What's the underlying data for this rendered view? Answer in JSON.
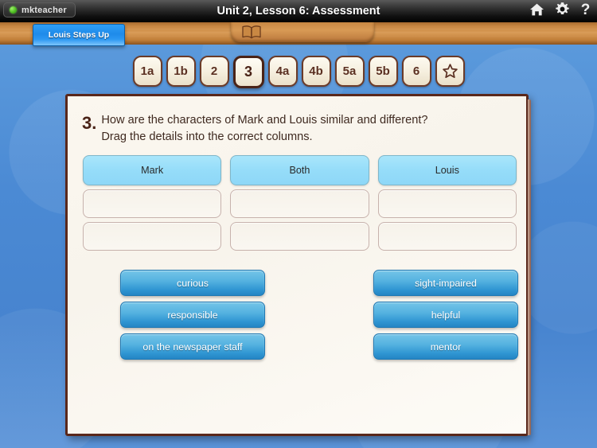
{
  "topbar": {
    "user_name": "mkteacher",
    "status_dot": "online-green",
    "title": "Unit 2, Lesson 6: Assessment",
    "icons": [
      {
        "name": "home-icon",
        "label": "Home"
      },
      {
        "name": "gear-icon",
        "label": "Settings"
      },
      {
        "name": "help-icon",
        "label": "Help"
      }
    ]
  },
  "shelf": {
    "book_icon": "open-book-icon",
    "lesson_tab_label": "Louis Steps Up"
  },
  "nav": {
    "items": [
      {
        "label": "1a",
        "active": false
      },
      {
        "label": "1b",
        "active": false
      },
      {
        "label": "2",
        "active": false
      },
      {
        "label": "3",
        "active": true
      },
      {
        "label": "4a",
        "active": false
      },
      {
        "label": "4b",
        "active": false
      },
      {
        "label": "5a",
        "active": false
      },
      {
        "label": "5b",
        "active": false
      },
      {
        "label": "6",
        "active": false
      }
    ],
    "star_label": "star-icon"
  },
  "question": {
    "number": "3.",
    "line1": "How are the characters of Mark and Louis similar and different?",
    "line2": "Drag the details into the correct columns."
  },
  "columns": [
    {
      "header": "Mark",
      "slots": [
        "",
        ""
      ]
    },
    {
      "header": "Both",
      "slots": [
        "",
        ""
      ]
    },
    {
      "header": "Louis",
      "slots": [
        "",
        ""
      ]
    }
  ],
  "tiles": {
    "left": [
      "curious",
      "responsible",
      "on the newspaper staff"
    ],
    "right": [
      "sight-impaired",
      "helpful",
      "mentor"
    ]
  },
  "colors": {
    "background_blue": "#4b8ad4",
    "shelf_wood": "#c98843",
    "card_paper": "#faf6ee",
    "card_border": "#5a281b",
    "header_cyan": "#96ddf9",
    "tile_blue": "#2f95d2",
    "tab_blue": "#1f8bea",
    "pill_cream": "#f5eedd",
    "pill_border": "#6b3b29"
  }
}
